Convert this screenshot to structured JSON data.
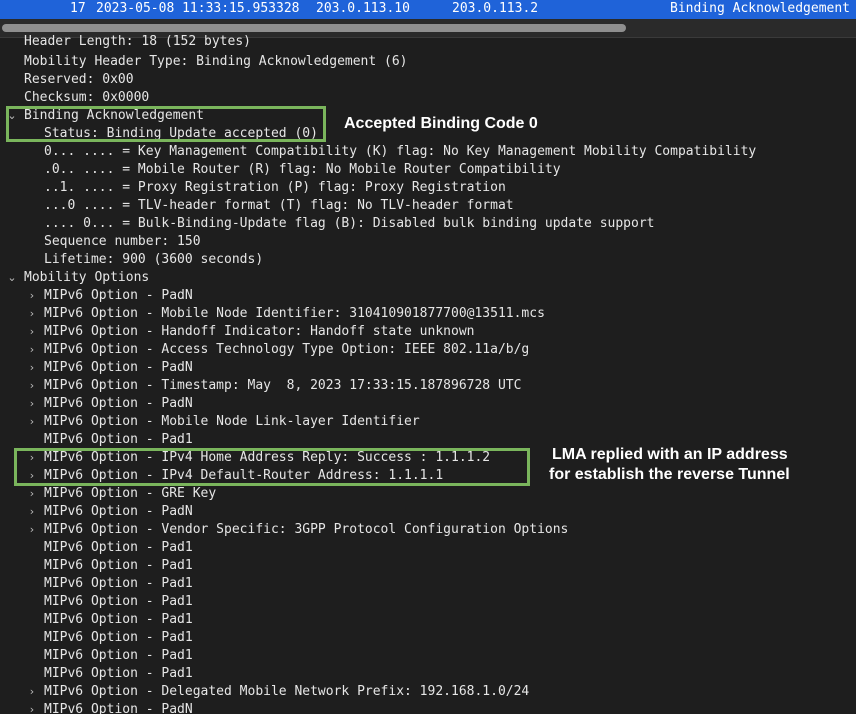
{
  "packet_row": {
    "no": "17",
    "time": "2023-05-08 11:33:15.953328",
    "source": "203.0.113.10",
    "destination": "203.0.113.2",
    "info": "Binding Acknowledgement"
  },
  "tree": [
    {
      "text": "Header Length: 18 (152 bytes)",
      "indent": 0,
      "arrow": ""
    },
    {
      "text": "Mobility Header Type: Binding Acknowledgement (6)",
      "indent": 0,
      "arrow": ""
    },
    {
      "text": "Reserved: 0x00",
      "indent": 0,
      "arrow": ""
    },
    {
      "text": "Checksum: 0x0000",
      "indent": 0,
      "arrow": ""
    },
    {
      "text": "Binding Acknowledgement",
      "indent": 0,
      "arrow": "expanded"
    },
    {
      "text": "Status: Binding Update accepted (0)",
      "indent": 1,
      "arrow": ""
    },
    {
      "text": "0... .... = Key Management Compatibility (K) flag: No Key Management Mobility Compatibility",
      "indent": 1,
      "arrow": ""
    },
    {
      "text": ".0.. .... = Mobile Router (R) flag: No Mobile Router Compatibility",
      "indent": 1,
      "arrow": ""
    },
    {
      "text": "..1. .... = Proxy Registration (P) flag: Proxy Registration",
      "indent": 1,
      "arrow": ""
    },
    {
      "text": "...0 .... = TLV-header format (T) flag: No TLV-header format",
      "indent": 1,
      "arrow": ""
    },
    {
      "text": ".... 0... = Bulk-Binding-Update flag (B): Disabled bulk binding update support",
      "indent": 1,
      "arrow": ""
    },
    {
      "text": "Sequence number: 150",
      "indent": 1,
      "arrow": ""
    },
    {
      "text": "Lifetime: 900 (3600 seconds)",
      "indent": 1,
      "arrow": ""
    },
    {
      "text": "Mobility Options",
      "indent": 0,
      "arrow": "expanded"
    },
    {
      "text": "MIPv6 Option - PadN",
      "indent": 1,
      "arrow": "collapsed"
    },
    {
      "text": "MIPv6 Option - Mobile Node Identifier: 310410901877700@13511.mcs",
      "indent": 1,
      "arrow": "collapsed"
    },
    {
      "text": "MIPv6 Option - Handoff Indicator: Handoff state unknown",
      "indent": 1,
      "arrow": "collapsed"
    },
    {
      "text": "MIPv6 Option - Access Technology Type Option: IEEE 802.11a/b/g",
      "indent": 1,
      "arrow": "collapsed"
    },
    {
      "text": "MIPv6 Option - PadN",
      "indent": 1,
      "arrow": "collapsed"
    },
    {
      "text": "MIPv6 Option - Timestamp: May  8, 2023 17:33:15.187896728 UTC",
      "indent": 1,
      "arrow": "collapsed"
    },
    {
      "text": "MIPv6 Option - PadN",
      "indent": 1,
      "arrow": "collapsed"
    },
    {
      "text": "MIPv6 Option - Mobile Node Link-layer Identifier",
      "indent": 1,
      "arrow": "collapsed"
    },
    {
      "text": "MIPv6 Option - Pad1",
      "indent": 1,
      "arrow": ""
    },
    {
      "text": "MIPv6 Option - IPv4 Home Address Reply: Success : 1.1.1.2",
      "indent": 1,
      "arrow": "collapsed"
    },
    {
      "text": "MIPv6 Option - IPv4 Default-Router Address: 1.1.1.1",
      "indent": 1,
      "arrow": "collapsed"
    },
    {
      "text": "MIPv6 Option - GRE Key",
      "indent": 1,
      "arrow": "collapsed"
    },
    {
      "text": "MIPv6 Option - PadN",
      "indent": 1,
      "arrow": "collapsed"
    },
    {
      "text": "MIPv6 Option - Vendor Specific: 3GPP Protocol Configuration Options",
      "indent": 1,
      "arrow": "collapsed"
    },
    {
      "text": "MIPv6 Option - Pad1",
      "indent": 1,
      "arrow": ""
    },
    {
      "text": "MIPv6 Option - Pad1",
      "indent": 1,
      "arrow": ""
    },
    {
      "text": "MIPv6 Option - Pad1",
      "indent": 1,
      "arrow": ""
    },
    {
      "text": "MIPv6 Option - Pad1",
      "indent": 1,
      "arrow": ""
    },
    {
      "text": "MIPv6 Option - Pad1",
      "indent": 1,
      "arrow": ""
    },
    {
      "text": "MIPv6 Option - Pad1",
      "indent": 1,
      "arrow": ""
    },
    {
      "text": "MIPv6 Option - Pad1",
      "indent": 1,
      "arrow": ""
    },
    {
      "text": "MIPv6 Option - Pad1",
      "indent": 1,
      "arrow": ""
    },
    {
      "text": "MIPv6 Option - Delegated Mobile Network Prefix: 192.168.1.0/24",
      "indent": 1,
      "arrow": "collapsed"
    },
    {
      "text": "MIPv6 Option - PadN",
      "indent": 1,
      "arrow": "collapsed"
    }
  ],
  "annotations": {
    "binding_note": "Accepted Binding Code 0",
    "lma_note_line1": "LMA replied with an IP address",
    "lma_note_line2": "for establish the reverse Tunnel"
  },
  "colors": {
    "selection": "#1f63d9",
    "highlight_box": "#7ab55c",
    "background": "#1e1e1e"
  }
}
